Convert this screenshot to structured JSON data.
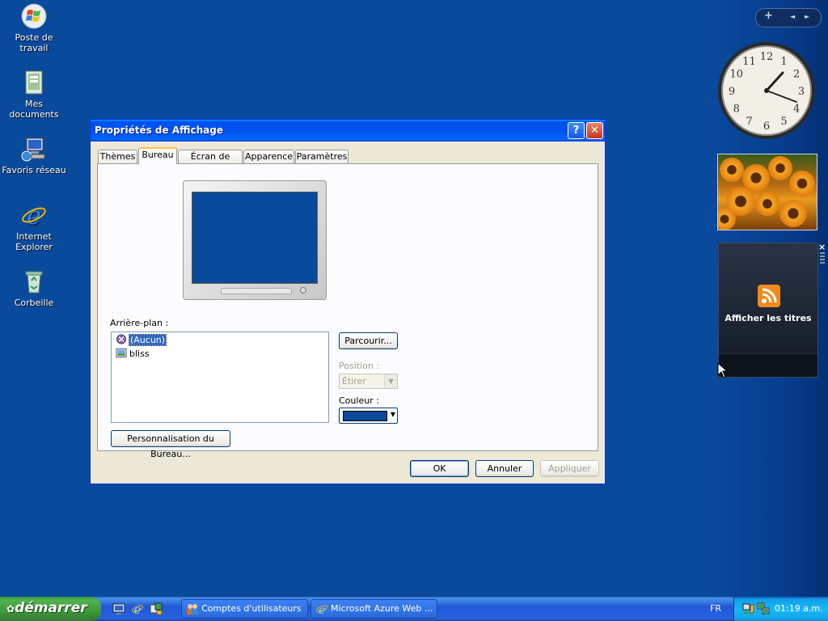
{
  "desktop": {
    "icons": [
      {
        "label": "Poste de travail"
      },
      {
        "label": "Mes documents"
      },
      {
        "label": "Favoris réseau"
      },
      {
        "label": "Internet Explorer"
      },
      {
        "label": "Corbeille"
      }
    ]
  },
  "sidebar": {
    "controls": {
      "add": "+",
      "prev": "◄",
      "next": "►"
    },
    "clock": {
      "numbers": [
        "12",
        "1",
        "2",
        "3",
        "4",
        "5",
        "6",
        "7",
        "8",
        "9",
        "10",
        "11"
      ]
    },
    "feed": {
      "title": "Afficher les titres",
      "close": "×"
    }
  },
  "dialog": {
    "title": "Propriétés de Affichage",
    "help": "?",
    "close": "✕",
    "tabs": [
      {
        "label": "Thèmes",
        "active": false
      },
      {
        "label": "Bureau",
        "active": true
      },
      {
        "label": "Écran de veille",
        "active": false
      },
      {
        "label": "Apparence",
        "active": false
      },
      {
        "label": "Paramètres",
        "active": false
      }
    ],
    "background_label": "Arrière-plan :",
    "background_items": [
      {
        "label": "(Aucun)",
        "selected": true
      },
      {
        "label": "bliss",
        "selected": false
      }
    ],
    "browse_button": "Parcourir...",
    "position_label": "Position :",
    "position_value": "Étirer",
    "color_label": "Couleur :",
    "color_value": "#0a4a9c",
    "customize_button": "Personnalisation du Bureau...",
    "ok_button": "OK",
    "cancel_button": "Annuler",
    "apply_button": "Appliquer"
  },
  "taskbar": {
    "start_label": "démarrer",
    "tasks": [
      {
        "label": "Comptes d'utilisateurs"
      },
      {
        "label": "Microsoft Azure Web ..."
      }
    ],
    "language": "FR",
    "time": "01:19 a.m."
  },
  "colors": {
    "desktop": "#0a4a9c",
    "titlebar": "#0050ee",
    "taskbar": "#2157d7",
    "start": "#3e9a3c",
    "tray": "#18b9f5"
  }
}
